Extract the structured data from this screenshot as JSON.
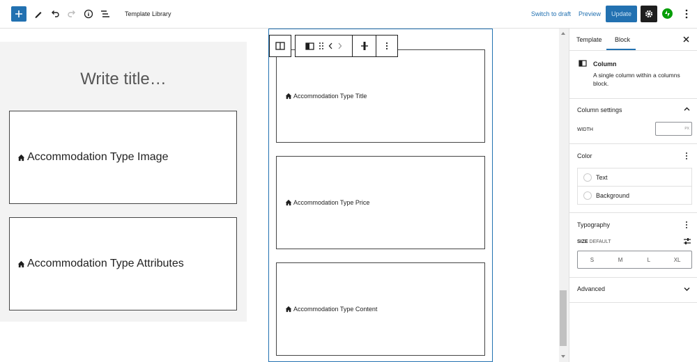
{
  "topbar": {
    "title": "Template Library",
    "switch_to_draft": "Switch to draft",
    "preview": "Preview",
    "update": "Update"
  },
  "canvas": {
    "write_title_placeholder": "Write title…",
    "left_blocks": [
      "Accommodation Type Image",
      "Accommodation Type Attributes"
    ],
    "right_blocks": [
      "Accommodation Type Title",
      "Accommodation Type Price",
      "Accommodation Type Content"
    ]
  },
  "sidebar": {
    "tabs": [
      "Template",
      "Block"
    ],
    "active_tab": "Block",
    "block_name": "Column",
    "block_description": "A single column within a columns block.",
    "column_settings": {
      "heading": "Column settings",
      "width_label": "WIDTH",
      "width_value": "",
      "width_unit": "PX"
    },
    "color": {
      "heading": "Color",
      "items": [
        "Text",
        "Background"
      ]
    },
    "typography": {
      "heading": "Typography",
      "size_label": "SIZE",
      "size_default": "DEFAULT",
      "sizes": [
        "S",
        "M",
        "L",
        "XL"
      ]
    },
    "advanced": {
      "heading": "Advanced"
    }
  },
  "colors": {
    "accent": "#2271b1",
    "jetpack": "#069e08",
    "dark": "#1e1e1e"
  },
  "icons": {
    "add": "plus-icon",
    "edit": "pencil-icon",
    "undo": "undo-icon",
    "redo": "redo-icon",
    "info": "info-icon",
    "list_view": "list-view-icon",
    "settings": "gear-icon",
    "jetpack": "jetpack-icon",
    "more": "kebab-icon",
    "block": "house-icon"
  }
}
